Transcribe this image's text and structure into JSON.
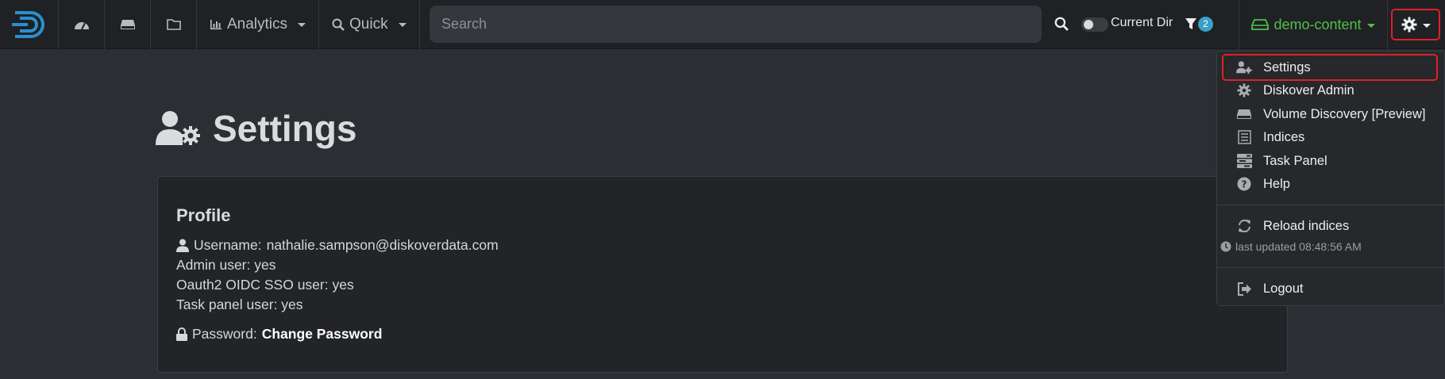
{
  "navbar": {
    "analytics_label": "Analytics",
    "quick_label": "Quick",
    "search_placeholder": "Search",
    "current_dir_label": "Current Dir",
    "filter_count": "2",
    "index_name": "demo-content"
  },
  "page": {
    "title": "Settings"
  },
  "profile": {
    "heading": "Profile",
    "username_label": "Username:",
    "username_value": "nathalie.sampson@diskoverdata.com",
    "admin_user": "Admin user: yes",
    "oauth_user": "Oauth2 OIDC SSO user: yes",
    "task_panel_user": "Task panel user: yes",
    "password_label": "Password:",
    "change_password": "Change Password"
  },
  "menu": {
    "settings": "Settings",
    "diskover_admin": "Diskover Admin",
    "volume_discovery": "Volume Discovery [Preview]",
    "indices": "Indices",
    "task_panel": "Task Panel",
    "help": "Help",
    "reload_indices": "Reload indices",
    "last_updated": "last updated 08:48:56 AM",
    "logout": "Logout"
  },
  "colors": {
    "accent_green": "#4fc04a",
    "highlight_red": "#e0202a",
    "badge_blue": "#3aa0c9"
  }
}
